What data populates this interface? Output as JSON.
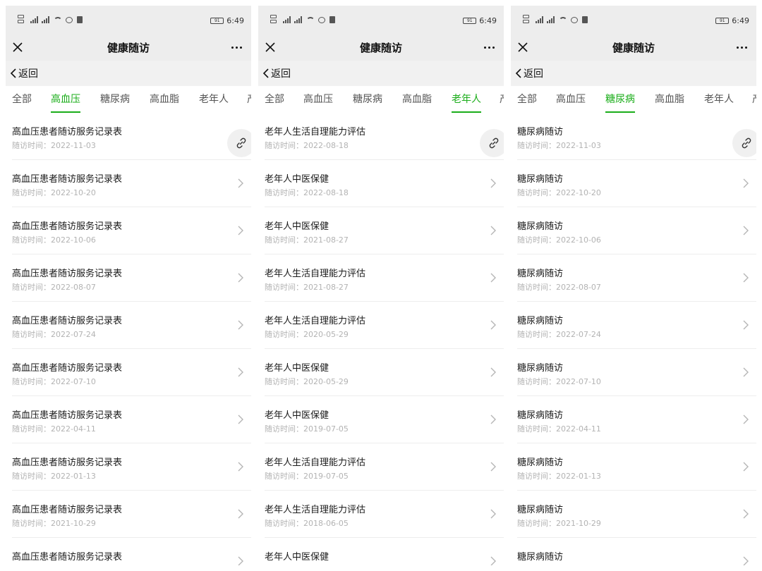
{
  "status": {
    "battery": "91",
    "time": "6:49"
  },
  "nav": {
    "title": "健康随访"
  },
  "back": {
    "label": "返回"
  },
  "date_prefix": "随访时间：",
  "colors": {
    "accent": "#1aad19",
    "nav_bg": "#ededed",
    "muted_text": "#b3b3b3"
  },
  "screens": [
    {
      "tabs": [
        "全部",
        "高血压",
        "糖尿病",
        "高血脂",
        "老年人",
        "产"
      ],
      "active_tab": 1,
      "items": [
        {
          "title": "高血压患者随访服务记录表",
          "date": "随访时间：2022-11-03"
        },
        {
          "title": "高血压患者随访服务记录表",
          "date": "随访时间：2022-10-20"
        },
        {
          "title": "高血压患者随访服务记录表",
          "date": "随访时间：2022-10-06"
        },
        {
          "title": "高血压患者随访服务记录表",
          "date": "随访时间：2022-08-07"
        },
        {
          "title": "高血压患者随访服务记录表",
          "date": "随访时间：2022-07-24"
        },
        {
          "title": "高血压患者随访服务记录表",
          "date": "随访时间：2022-07-10"
        },
        {
          "title": "高血压患者随访服务记录表",
          "date": "随访时间：2022-04-11"
        },
        {
          "title": "高血压患者随访服务记录表",
          "date": "随访时间：2022-01-13"
        },
        {
          "title": "高血压患者随访服务记录表",
          "date": "随访时间：2021-10-29"
        },
        {
          "title": "高血压患者随访服务记录表",
          "date": ""
        }
      ]
    },
    {
      "tabs": [
        "全部",
        "高血压",
        "糖尿病",
        "高血脂",
        "老年人",
        "产"
      ],
      "active_tab": 4,
      "items": [
        {
          "title": "老年人生活自理能力评估",
          "date": "随访时间：2022-08-18"
        },
        {
          "title": "老年人中医保健",
          "date": "随访时间：2022-08-18"
        },
        {
          "title": "老年人中医保健",
          "date": "随访时间：2021-08-27"
        },
        {
          "title": "老年人生活自理能力评估",
          "date": "随访时间：2021-08-27"
        },
        {
          "title": "老年人生活自理能力评估",
          "date": "随访时间：2020-05-29"
        },
        {
          "title": "老年人中医保健",
          "date": "随访时间：2020-05-29"
        },
        {
          "title": "老年人中医保健",
          "date": "随访时间：2019-07-05"
        },
        {
          "title": "老年人生活自理能力评估",
          "date": "随访时间：2019-07-05"
        },
        {
          "title": "老年人生活自理能力评估",
          "date": "随访时间：2018-06-05"
        },
        {
          "title": "老年人中医保健",
          "date": ""
        }
      ]
    },
    {
      "tabs": [
        "全部",
        "高血压",
        "糖尿病",
        "高血脂",
        "老年人",
        "产"
      ],
      "active_tab": 2,
      "items": [
        {
          "title": "糖尿病随访",
          "date": "随访时间：2022-11-03"
        },
        {
          "title": "糖尿病随访",
          "date": "随访时间：2022-10-20"
        },
        {
          "title": "糖尿病随访",
          "date": "随访时间：2022-10-06"
        },
        {
          "title": "糖尿病随访",
          "date": "随访时间：2022-08-07"
        },
        {
          "title": "糖尿病随访",
          "date": "随访时间：2022-07-24"
        },
        {
          "title": "糖尿病随访",
          "date": "随访时间：2022-07-10"
        },
        {
          "title": "糖尿病随访",
          "date": "随访时间：2022-04-11"
        },
        {
          "title": "糖尿病随访",
          "date": "随访时间：2022-01-13"
        },
        {
          "title": "糖尿病随访",
          "date": "随访时间：2021-10-29"
        },
        {
          "title": "糖尿病随访",
          "date": ""
        }
      ]
    }
  ]
}
